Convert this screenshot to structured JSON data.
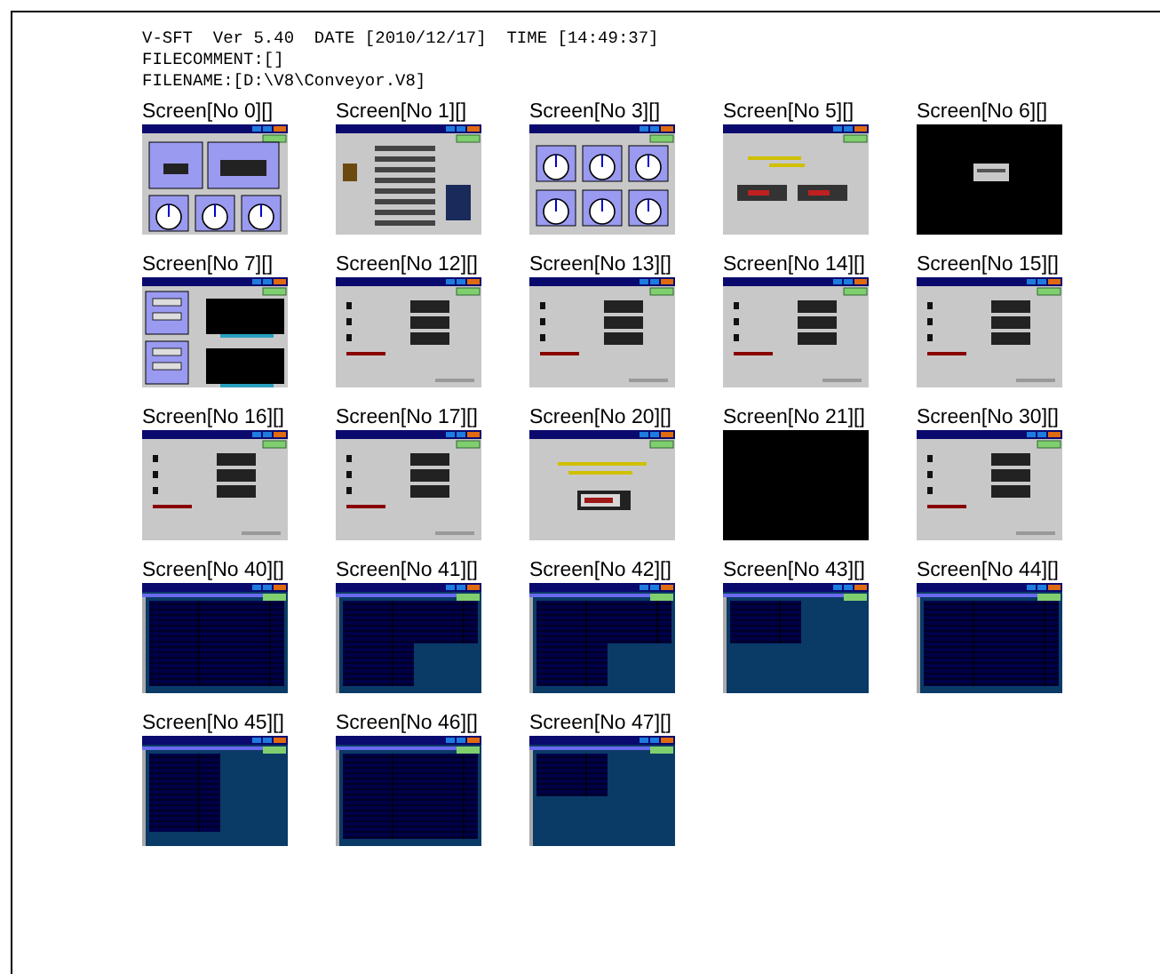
{
  "header": {
    "lines": [
      "V-SFT  Ver 5.40  DATE [2010/12/17]  TIME [14:49:37]",
      "FILECOMMENT:[]",
      "FILENAME:[D:\\V8\\Conveyor.V8]"
    ]
  },
  "screens": [
    {
      "label": "Screen[No 0][]",
      "kind": "menu"
    },
    {
      "label": "Screen[No 1][]",
      "kind": "list"
    },
    {
      "label": "Screen[No 3][]",
      "kind": "meters"
    },
    {
      "label": "Screen[No 5][]",
      "kind": "message"
    },
    {
      "label": "Screen[No 6][]",
      "kind": "dialog"
    },
    {
      "label": "Screen[No 7][]",
      "kind": "graphs"
    },
    {
      "label": "Screen[No 12][]",
      "kind": "settings"
    },
    {
      "label": "Screen[No 13][]",
      "kind": "settings"
    },
    {
      "label": "Screen[No 14][]",
      "kind": "settings"
    },
    {
      "label": "Screen[No 15][]",
      "kind": "settings"
    },
    {
      "label": "Screen[No 16][]",
      "kind": "settings"
    },
    {
      "label": "Screen[No 17][]",
      "kind": "settings"
    },
    {
      "label": "Screen[No 20][]",
      "kind": "notice"
    },
    {
      "label": "Screen[No 21][]",
      "kind": "blank"
    },
    {
      "label": "Screen[No 30][]",
      "kind": "settings"
    },
    {
      "label": "Screen[No 40][]",
      "kind": "table-full"
    },
    {
      "label": "Screen[No 41][]",
      "kind": "table-half"
    },
    {
      "label": "Screen[No 42][]",
      "kind": "table-half"
    },
    {
      "label": "Screen[No 43][]",
      "kind": "table-small"
    },
    {
      "label": "Screen[No 44][]",
      "kind": "table-full"
    },
    {
      "label": "Screen[No 45][]",
      "kind": "table-left"
    },
    {
      "label": "Screen[No 46][]",
      "kind": "table-full"
    },
    {
      "label": "Screen[No 47][]",
      "kind": "table-small"
    }
  ]
}
